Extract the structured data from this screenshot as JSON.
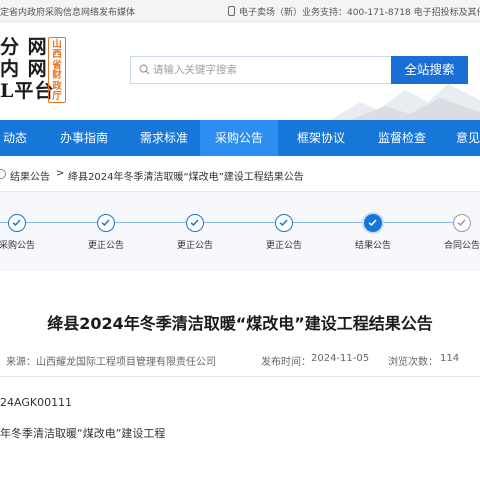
{
  "topbar": {
    "left_text": "定省内政府采购信息网络发布媒体",
    "right_text": "电子卖场（新）业务支持：400-171-8718  电子招投标及其他"
  },
  "header": {
    "logo_lines": [
      "分 网",
      "内 网",
      "L平台"
    ],
    "seal_text": "山西省财政厅",
    "search_placeholder": "请输入关键字搜索",
    "search_button": "全站搜索"
  },
  "nav": {
    "items": [
      {
        "label": "动态"
      },
      {
        "label": "办事指南"
      },
      {
        "label": "需求标准"
      },
      {
        "label": "采购公告",
        "active": true
      },
      {
        "label": "框架协议"
      },
      {
        "label": "监督检查"
      },
      {
        "label": "意见"
      }
    ]
  },
  "breadcrumb": {
    "level1": "结果公告",
    "sep": ">",
    "level2": "绛县2024年冬季清洁取暖“煤改电”建设工程结果公告"
  },
  "steps": [
    {
      "label": "采购公告",
      "state": "done"
    },
    {
      "label": "更正公告",
      "state": "done"
    },
    {
      "label": "更正公告",
      "state": "done"
    },
    {
      "label": "更正公告",
      "state": "done"
    },
    {
      "label": "结果公告",
      "state": "current"
    },
    {
      "label": "合同公告",
      "state": "future"
    }
  ],
  "article": {
    "title": "绛县2024年冬季清洁取暖“煤改电”建设工程结果公告",
    "source": "来源：山西耀龙国际工程项目管理有限责任公司",
    "publish_time_label": "发布时间：",
    "publish_time": "2024-11-05",
    "views_label": "浏览次数：",
    "views": "114",
    "line1": "24AGK00111",
    "line2": "年冬季清洁取暖“煤改电”建设工程"
  },
  "colors": {
    "nav_bg": "#1677d9",
    "nav_active": "#2e8df0",
    "search_button": "#1a6fd6",
    "seal": "#e5731f"
  }
}
